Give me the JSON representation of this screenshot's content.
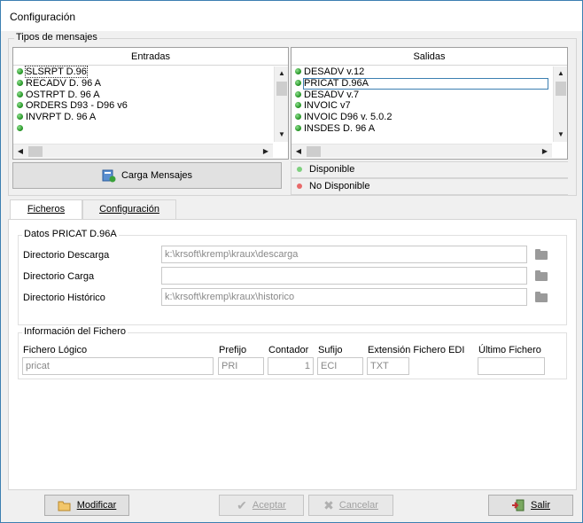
{
  "window": {
    "title": "Configuración"
  },
  "tipos": {
    "title": "Tipos de mensajes",
    "entradas": {
      "header": "Entradas",
      "items": [
        "SLSRPT D.96",
        "RECADV D. 96 A",
        "OSTRPT D. 96 A",
        "ORDERS D93 - D96 v6",
        "INVRPT D. 96 A",
        ""
      ]
    },
    "salidas": {
      "header": "Salidas",
      "items": [
        "DESADV v.12",
        "PRICAT D.96A",
        "DESADV v.7",
        "INVOIC v7",
        "INVOIC D96 v. 5.0.2",
        "INSDES D. 96 A"
      ]
    },
    "carga_button": "Carga Mensajes",
    "legend": {
      "disponible": "Disponible",
      "no_disponible": "No Disponible"
    },
    "colors": {
      "disponible": "#2e9e2e",
      "no_disponible": "#e05050"
    }
  },
  "tabs": [
    {
      "label": "Ficheros"
    },
    {
      "label": "Configuración"
    }
  ],
  "ficheros": {
    "datos_title": "Datos PRICAT D.96A",
    "dir_descarga_label": "Directorio Descarga",
    "dir_descarga_value": "k:\\krsoft\\kremp\\kraux\\descarga",
    "dir_carga_label": "Directorio Carga",
    "dir_carga_value": "",
    "dir_historico_label": "Directorio Histórico",
    "dir_historico_value": "k:\\krsoft\\kremp\\kraux\\historico",
    "info_title": "Información del Fichero",
    "fichero_logico_label": "Fichero Lógico",
    "fichero_logico_value": "pricat",
    "prefijo_label": "Prefijo",
    "prefijo_value": "PRI",
    "contador_label": "Contador",
    "contador_value": "1",
    "sufijo_label": "Sufijo",
    "sufijo_value": "ECI",
    "extension_label": "Extensión Fichero EDI",
    "extension_value": "TXT",
    "ultimo_label": "Último Fichero",
    "ultimo_value": ""
  },
  "footer": {
    "modificar": "Modificar",
    "aceptar": "Aceptar",
    "cancelar": "Cancelar",
    "salir": "Salir"
  }
}
